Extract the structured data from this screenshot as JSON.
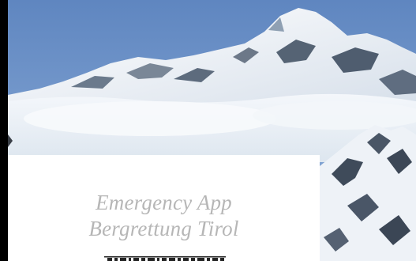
{
  "splash": {
    "title_line1": "Emergency App",
    "title_line2": "Bergrettung Tirol"
  },
  "colors": {
    "sky": "#6f93c7",
    "fog": "#eef3f8",
    "card": "#ffffff",
    "title_text": "#b6b6b6",
    "frame": "#000000"
  },
  "icons": {
    "logo": "bergrettung-tirol-logo"
  }
}
